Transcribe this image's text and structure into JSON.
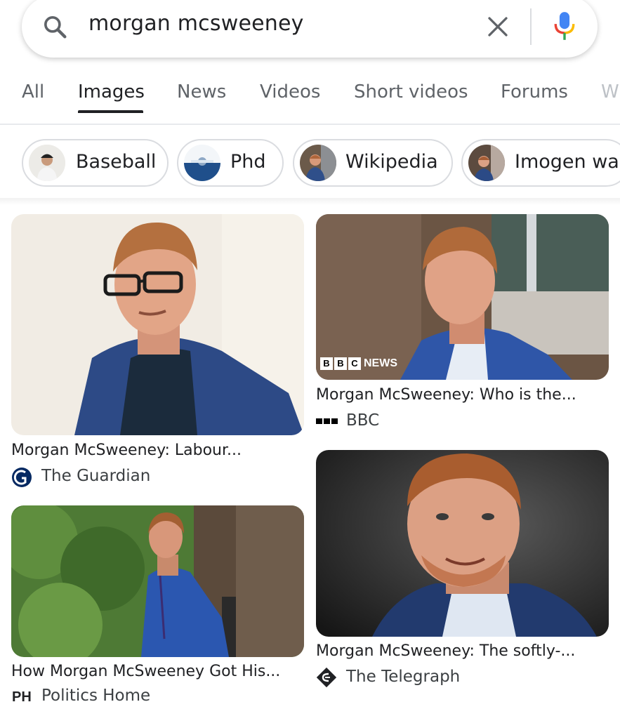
{
  "search": {
    "query": "morgan mcsweeney",
    "icons": {
      "search": "search-icon",
      "clear": "close-icon",
      "voice": "microphone-icon"
    }
  },
  "tabs": [
    {
      "label": "All",
      "active": false
    },
    {
      "label": "Images",
      "active": true
    },
    {
      "label": "News",
      "active": false
    },
    {
      "label": "Videos",
      "active": false
    },
    {
      "label": "Short videos",
      "active": false
    },
    {
      "label": "Forums",
      "active": false
    },
    {
      "label": "W",
      "active": false
    }
  ],
  "chips": [
    {
      "label": "Baseball"
    },
    {
      "label": "Phd"
    },
    {
      "label": "Wikipedia"
    },
    {
      "label": "Imogen wall"
    }
  ],
  "results": [
    {
      "title": "Morgan McSweeney: Labour...",
      "source": "The Guardian",
      "source_icon": "guardian-logo-icon"
    },
    {
      "title": "Morgan McSweeney: Who is the...",
      "source": "BBC",
      "source_icon": "bbc-logo-icon",
      "image_overlay": "NEWS"
    },
    {
      "title": "How Morgan McSweeney Got His...",
      "source": "Politics Home",
      "source_icon": "politicshome-logo-icon",
      "source_icon_text": "PH"
    },
    {
      "title": "Morgan McSweeney: The softly-...",
      "source": "The Telegraph",
      "source_icon": "telegraph-logo-icon"
    }
  ],
  "colors": {
    "active_tab": "#202124",
    "inactive_tab": "#5f6368",
    "guardian_blue": "#052962",
    "bbc_black": "#000000"
  }
}
